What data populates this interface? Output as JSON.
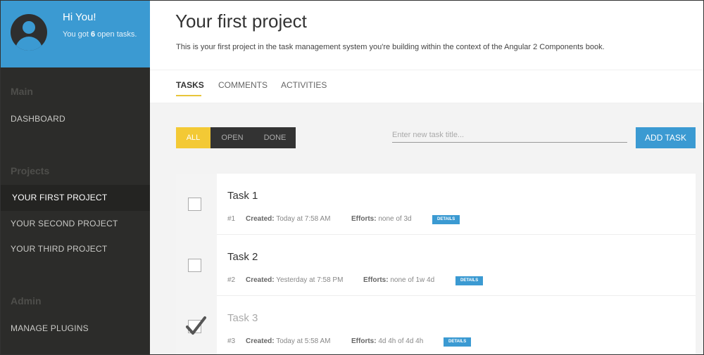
{
  "user": {
    "greeting": "Hi You!",
    "open_prefix": "You got",
    "open_count": "6",
    "open_suffix": "open tasks."
  },
  "sidebar": {
    "sections": [
      {
        "heading": "Main",
        "items": [
          "DASHBOARD"
        ]
      },
      {
        "heading": "Projects",
        "items": [
          "YOUR FIRST PROJECT",
          "YOUR SECOND PROJECT",
          "YOUR THIRD PROJECT"
        ]
      },
      {
        "heading": "Admin",
        "items": [
          "MANAGE PLUGINS"
        ]
      }
    ],
    "active_item": "YOUR FIRST PROJECT"
  },
  "project": {
    "title": "Your first project",
    "description": "This is your first project in the task management system you're building within the context of the Angular 2 Components book."
  },
  "tabs": [
    "TASKS",
    "COMMENTS",
    "ACTIVITIES"
  ],
  "filters": [
    "ALL",
    "OPEN",
    "DONE"
  ],
  "new_task": {
    "placeholder": "Enter new task title...",
    "button": "ADD TASK"
  },
  "labels": {
    "created": "Created:",
    "efforts": "Efforts:",
    "details": "DETAILS"
  },
  "tasks": [
    {
      "title": "Task 1",
      "number": "#1",
      "created": "Today at 7:58 AM",
      "efforts": "none of 3d",
      "done": false
    },
    {
      "title": "Task 2",
      "number": "#2",
      "created": "Yesterday at 7:58 PM",
      "efforts": "none of 1w 4d",
      "done": false
    },
    {
      "title": "Task 3",
      "number": "#3",
      "created": "Today at 5:58 AM",
      "efforts": "4d 4h of 4d 4h",
      "done": true
    }
  ],
  "colors": {
    "accent_blue": "#3b9ad2",
    "accent_yellow": "#f3c935",
    "sidebar_bg": "#2c2c2a"
  }
}
